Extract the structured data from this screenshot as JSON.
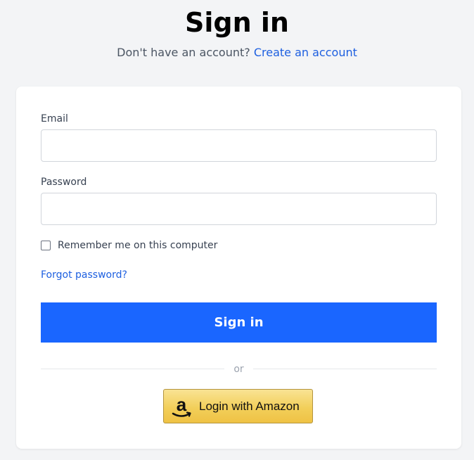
{
  "header": {
    "title": "Sign in",
    "subtitle_prefix": "Don't have an account?",
    "create_account_link": "Create an account"
  },
  "form": {
    "email_label": "Email",
    "email_value": "",
    "password_label": "Password",
    "password_value": "",
    "remember_label": "Remember me on this computer",
    "remember_checked": false,
    "forgot_link": "Forgot password?",
    "submit_label": "Sign in",
    "divider_text": "or",
    "amazon_label": "Login with Amazon",
    "amazon_icon": "amazon-logo-icon"
  },
  "colors": {
    "accent": "#1a66ff",
    "link": "#1d5fe0",
    "background": "#f3f4f6"
  }
}
